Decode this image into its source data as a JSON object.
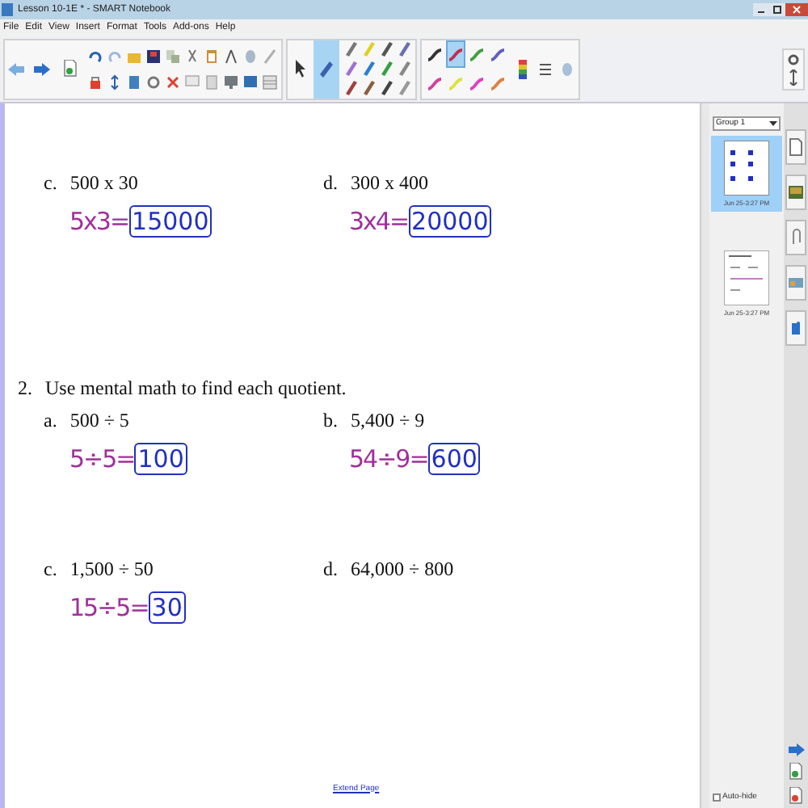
{
  "window": {
    "title": "Lesson 10-1E * - SMART Notebook"
  },
  "menu": [
    "File",
    "Edit",
    "View",
    "Insert",
    "Format",
    "Tools",
    "Add-ons",
    "Help"
  ],
  "toolbar": {
    "tools": [
      {
        "kind": "select",
        "selected": false
      },
      {
        "kind": "pen",
        "selected": true
      }
    ],
    "line_styles": [
      {
        "color": "#333333",
        "selected": false
      },
      {
        "color": "#c03050",
        "selected": true
      },
      {
        "color": "#40a040",
        "selected": false
      },
      {
        "color": "#6060c0",
        "selected": false
      },
      {
        "color": "#d040a0",
        "selected": false
      },
      {
        "color": "#e0e040",
        "selected": false
      },
      {
        "color": "#e040c0",
        "selected": false
      },
      {
        "color": "#e08040",
        "selected": false
      }
    ]
  },
  "page": {
    "top_problems": [
      {
        "letter": "c.",
        "expression": "500 x 30",
        "work": "5x3=",
        "answer": "15000"
      },
      {
        "letter": "d.",
        "expression": "300 x 400",
        "work": "3x4=",
        "answer": "20000"
      }
    ],
    "exercise": {
      "number": "2.",
      "instruction": "Use mental math to find each quotient.",
      "problems": [
        {
          "letter": "a.",
          "expression": "500 ÷ 5",
          "work": "5÷5=",
          "answer": "100"
        },
        {
          "letter": "b.",
          "expression": "5,400 ÷ 9",
          "work": "54÷9=",
          "answer": "600"
        },
        {
          "letter": "c.",
          "expression": "1,500 ÷ 50",
          "work": "15÷5=",
          "answer": "30"
        },
        {
          "letter": "d.",
          "expression": "64,000 ÷ 800"
        }
      ]
    },
    "extend_link": "Extend Page"
  },
  "side_panel": {
    "group": "Group 1",
    "pages": [
      {
        "caption": "Jun 25-3:27 PM",
        "selected": true
      },
      {
        "caption": "Jun 25-3:27 PM",
        "selected": false
      }
    ],
    "auto_hide": {
      "label": "Auto-hide",
      "checked": false
    }
  }
}
